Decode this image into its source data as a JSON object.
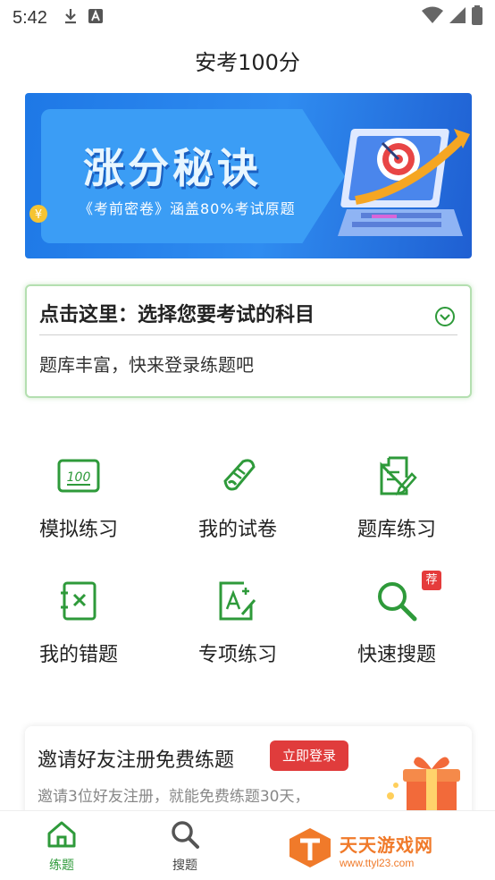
{
  "status_bar": {
    "time": "5:42",
    "icons": [
      "download-icon",
      "notification-a-icon",
      "wifi-icon",
      "signal-icon",
      "battery-icon"
    ]
  },
  "header": {
    "title": "安考100分"
  },
  "banner": {
    "headline": "涨分秘诀",
    "subtitle": "《考前密卷》涵盖80%考试原题",
    "slide_index": 2,
    "slide_count": 3
  },
  "subject_card": {
    "title": "点击这里：选择您要考试的科目",
    "description": "题库丰富，快来登录练题吧"
  },
  "features": [
    {
      "label": "模拟练习",
      "icon": "score-100-icon"
    },
    {
      "label": "我的试卷",
      "icon": "scroll-icon"
    },
    {
      "label": "题库练习",
      "icon": "edit-doc-icon"
    },
    {
      "label": "我的错题",
      "icon": "wrong-book-icon"
    },
    {
      "label": "专项练习",
      "icon": "grade-a-plus-icon"
    },
    {
      "label": "快速搜题",
      "icon": "search-icon",
      "badge": "荐"
    }
  ],
  "invite": {
    "title": "邀请好友注册免费练题",
    "button": "立即登录",
    "description": "邀请3位好友注册，就能免费练题30天，"
  },
  "bottom_nav": [
    {
      "label": "练题",
      "icon": "home-icon",
      "active": true
    },
    {
      "label": "搜题",
      "icon": "search-icon",
      "active": false
    }
  ],
  "watermark": {
    "title": "天天游戏网",
    "url": "www.ttyl23.com"
  },
  "colors": {
    "accent": "#2e9a3a",
    "banner_blue": "#2f8cf0",
    "badge_red": "#e53b3b",
    "watermark_orange": "#f07a2a"
  }
}
